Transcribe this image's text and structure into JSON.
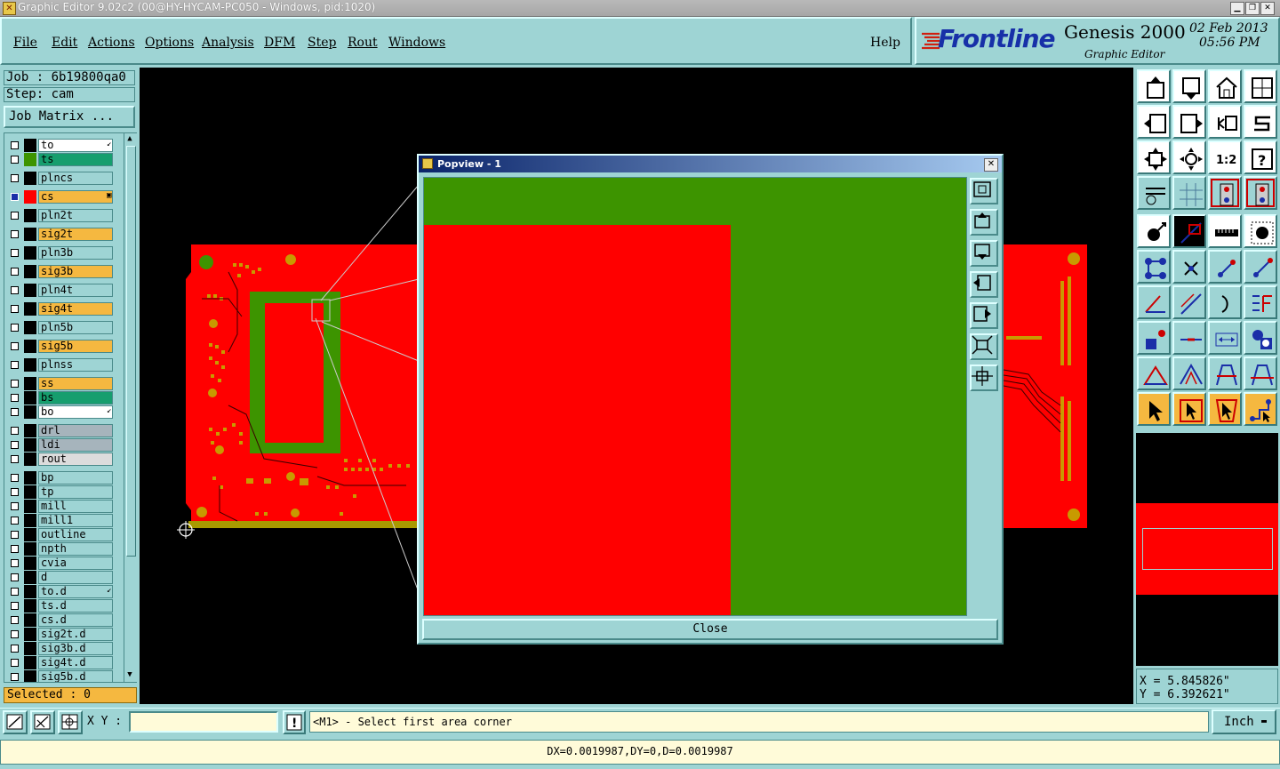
{
  "window": {
    "title": "Graphic Editor 9.02c2 (00@HY-HYCAM-PC050 - Windows, pid:1020)",
    "controls": [
      "minimize",
      "restore",
      "close"
    ]
  },
  "menubar": {
    "items": [
      "File",
      "Edit",
      "Actions",
      "Options",
      "Analysis",
      "DFM",
      "Step",
      "Rout",
      "Windows"
    ],
    "help": "Help"
  },
  "banner": {
    "brand": "Frontline",
    "product": "Genesis 2000",
    "subtitle": "Graphic Editor",
    "date": "02 Feb 2013",
    "time": "05:56 PM"
  },
  "job": {
    "job_line": "Job : 6b19800qa0",
    "step_line": "Step: cam",
    "matrix_button": "Job Matrix ..."
  },
  "layers": [
    {
      "name": "to",
      "color": "#ffffff",
      "swatch": "#000000",
      "checked": false,
      "mark": "arrow"
    },
    {
      "name": "ts",
      "color": "#169e6e",
      "swatch": "#3d9400",
      "checked": false
    },
    {
      "name": "plncs",
      "color": "#9ed4d4",
      "swatch": "#000000",
      "checked": false
    },
    {
      "name": "cs",
      "color": "#f5b840",
      "swatch": "#ff0000",
      "checked": true,
      "mark": "grid"
    },
    {
      "name": "pln2t",
      "color": "#9ed4d4",
      "swatch": "#000000",
      "checked": false
    },
    {
      "name": "sig2t",
      "color": "#f5b840",
      "swatch": "#000000",
      "checked": false
    },
    {
      "name": "pln3b",
      "color": "#9ed4d4",
      "swatch": "#000000",
      "checked": false
    },
    {
      "name": "sig3b",
      "color": "#f5b840",
      "swatch": "#000000",
      "checked": false
    },
    {
      "name": "pln4t",
      "color": "#9ed4d4",
      "swatch": "#000000",
      "checked": false
    },
    {
      "name": "sig4t",
      "color": "#f5b840",
      "swatch": "#000000",
      "checked": false
    },
    {
      "name": "pln5b",
      "color": "#9ed4d4",
      "swatch": "#000000",
      "checked": false
    },
    {
      "name": "sig5b",
      "color": "#f5b840",
      "swatch": "#000000",
      "checked": false
    },
    {
      "name": "plnss",
      "color": "#9ed4d4",
      "swatch": "#000000",
      "checked": false
    },
    {
      "name": "ss",
      "color": "#f5b840",
      "swatch": "#000000",
      "checked": false
    },
    {
      "name": "bs",
      "color": "#169e6e",
      "swatch": "#000000",
      "checked": false
    },
    {
      "name": "bo",
      "color": "#ffffff",
      "swatch": "#000000",
      "checked": false,
      "mark": "arrow"
    },
    {
      "name": "drl",
      "color": "#a6b4bc",
      "swatch": "#000000",
      "checked": false
    },
    {
      "name": "ldi",
      "color": "#a6b4bc",
      "swatch": "#000000",
      "checked": false
    },
    {
      "name": "rout",
      "color": "#dcdcdc",
      "swatch": "#000000",
      "checked": false
    },
    {
      "name": "bp",
      "color": "#9ed4d4",
      "swatch": "#000000",
      "checked": false
    },
    {
      "name": "tp",
      "color": "#9ed4d4",
      "swatch": "#000000",
      "checked": false
    },
    {
      "name": "mill",
      "color": "#9ed4d4",
      "swatch": "#000000",
      "checked": false
    },
    {
      "name": "mill1",
      "color": "#9ed4d4",
      "swatch": "#000000",
      "checked": false
    },
    {
      "name": "outline",
      "color": "#9ed4d4",
      "swatch": "#000000",
      "checked": false
    },
    {
      "name": "npth",
      "color": "#9ed4d4",
      "swatch": "#000000",
      "checked": false
    },
    {
      "name": "cvia",
      "color": "#9ed4d4",
      "swatch": "#000000",
      "checked": false
    },
    {
      "name": "d",
      "color": "#9ed4d4",
      "swatch": "#000000",
      "checked": false
    },
    {
      "name": "to.d",
      "color": "#9ed4d4",
      "swatch": "#000000",
      "checked": false,
      "mark": "arrow"
    },
    {
      "name": "ts.d",
      "color": "#9ed4d4",
      "swatch": "#000000",
      "checked": false
    },
    {
      "name": "cs.d",
      "color": "#9ed4d4",
      "swatch": "#000000",
      "checked": false
    },
    {
      "name": "sig2t.d",
      "color": "#9ed4d4",
      "swatch": "#000000",
      "checked": false
    },
    {
      "name": "sig3b.d",
      "color": "#9ed4d4",
      "swatch": "#000000",
      "checked": false
    },
    {
      "name": "sig4t.d",
      "color": "#9ed4d4",
      "swatch": "#000000",
      "checked": false
    },
    {
      "name": "sig5b.d",
      "color": "#9ed4d4",
      "swatch": "#000000",
      "checked": false
    }
  ],
  "selected": "Selected : 0",
  "popview": {
    "title": "Popview - 1",
    "close_button": "Close"
  },
  "coords": {
    "x": "X = 5.845826\"",
    "y": "Y = 6.392621\""
  },
  "bottom": {
    "xy_label": "X Y :",
    "xy_value": "",
    "message": "<M1> - Select first area corner",
    "units": "Inch",
    "status": "DX=0.0019987,DY=0,D=0.0019987"
  },
  "colors": {
    "panel": "#9ed4d4",
    "copper": "#ff0000",
    "mask": "#3d9400",
    "highlight": "#f5b840"
  }
}
